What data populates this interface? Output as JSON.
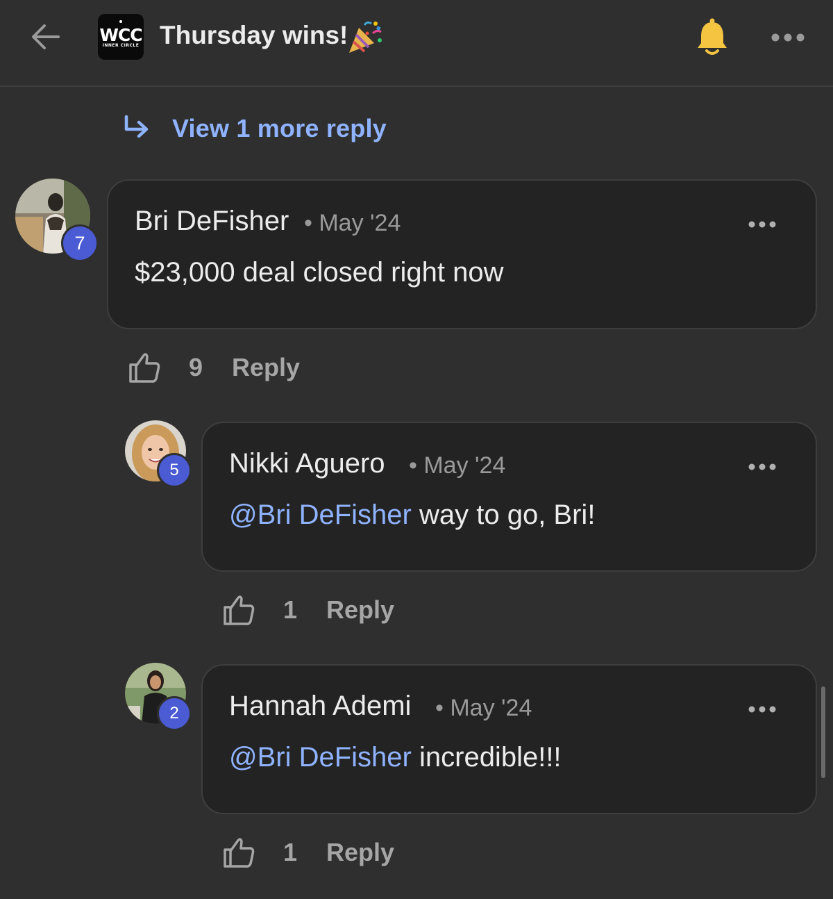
{
  "header": {
    "title": "Thursday wins!",
    "logo_text": "WCC",
    "logo_subtext": "INNER CIRCLE",
    "back_icon": "arrow-left-icon",
    "party_icon": "party-popper-icon",
    "bell_icon": "bell-icon",
    "more_icon": "more-horizontal-icon"
  },
  "view_more": {
    "label": "View 1 more reply",
    "icon": "reply-arrow-icon"
  },
  "comments": [
    {
      "author": "Bri DeFisher",
      "separator": "•",
      "date": "May '24",
      "level": "7",
      "mention": "",
      "text": "$23,000 deal closed right now",
      "likes": "9",
      "reply_label": "Reply"
    },
    {
      "author": "Nikki Aguero",
      "separator": "•",
      "date": "May '24",
      "level": "5",
      "mention": "@Bri DeFisher",
      "text": " way to go, Bri!",
      "likes": "1",
      "reply_label": "Reply"
    },
    {
      "author": "Hannah Ademi",
      "separator": "•",
      "date": "May '24",
      "level": "2",
      "mention": "@Bri DeFisher",
      "text": " incredible!!!",
      "likes": "1",
      "reply_label": "Reply"
    }
  ],
  "colors": {
    "background": "#2f2f2f",
    "card": "#232323",
    "link": "#8fb3ff",
    "level_badge": "#4a5bd4",
    "bell": "#f5c542"
  }
}
